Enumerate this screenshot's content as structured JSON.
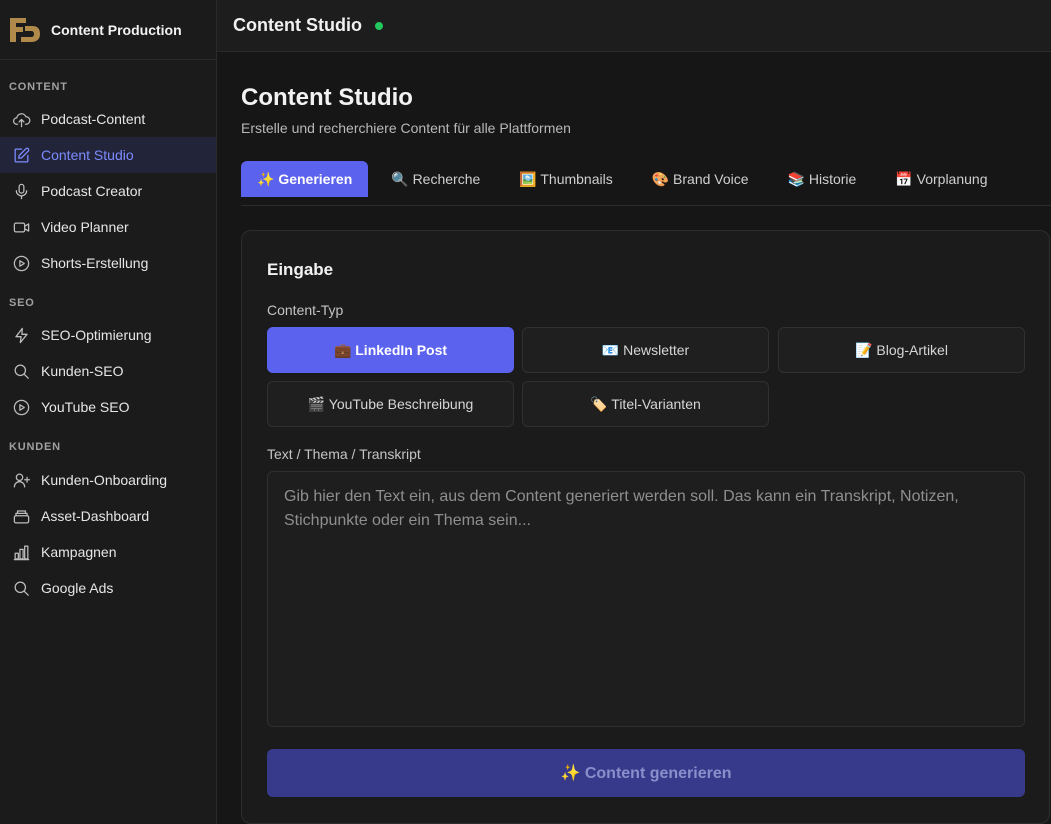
{
  "sidebar": {
    "brand": "Content Production",
    "sections": [
      {
        "label": "CONTENT",
        "items": [
          {
            "label": "Podcast-Content",
            "icon": "upload-cloud-icon"
          },
          {
            "label": "Content Studio",
            "icon": "edit-icon",
            "active": true
          },
          {
            "label": "Podcast Creator",
            "icon": "microphone-icon"
          },
          {
            "label": "Video Planner",
            "icon": "video-icon"
          },
          {
            "label": "Shorts-Erstellung",
            "icon": "play-circle-icon"
          }
        ]
      },
      {
        "label": "SEO",
        "items": [
          {
            "label": "SEO-Optimierung",
            "icon": "lightning-icon"
          },
          {
            "label": "Kunden-SEO",
            "icon": "search-icon"
          },
          {
            "label": "YouTube SEO",
            "icon": "play-circle-icon"
          }
        ]
      },
      {
        "label": "KUNDEN",
        "items": [
          {
            "label": "Kunden-Onboarding",
            "icon": "user-plus-icon"
          },
          {
            "label": "Asset-Dashboard",
            "icon": "stack-icon"
          },
          {
            "label": "Kampagnen",
            "icon": "bar-chart-icon"
          },
          {
            "label": "Google Ads",
            "icon": "search-icon"
          }
        ]
      }
    ]
  },
  "topbar": {
    "title": "Content Studio",
    "status_color": "#22c55e"
  },
  "page": {
    "title": "Content Studio",
    "subtitle": "Erstelle und recherchiere Content für alle Plattformen"
  },
  "tabs": [
    {
      "label": "✨ Generieren",
      "active": true
    },
    {
      "label": "🔍 Recherche"
    },
    {
      "label": "🖼️ Thumbnails"
    },
    {
      "label": "🎨 Brand Voice"
    },
    {
      "label": "📚 Historie"
    },
    {
      "label": "📅 Vorplanung"
    }
  ],
  "form": {
    "title": "Eingabe",
    "content_type_label": "Content-Typ",
    "content_types": [
      {
        "label": "💼 LinkedIn Post",
        "active": true
      },
      {
        "label": "📧 Newsletter"
      },
      {
        "label": "📝 Blog-Artikel"
      },
      {
        "label": "🎬 YouTube Beschreibung"
      },
      {
        "label": "🏷️ Titel-Varianten"
      }
    ],
    "text_label": "Text / Thema / Transkript",
    "text_value": "",
    "text_placeholder": "Gib hier den Text ein, aus dem Content generiert werden soll. Das kann ein Transkript, Notizen, Stichpunkte oder ein Thema sein...",
    "generate_label": "✨ Content generieren"
  },
  "colors": {
    "accent": "#5b62ee",
    "active_nav": "#7d8bff",
    "logo": "#b08a4a"
  }
}
